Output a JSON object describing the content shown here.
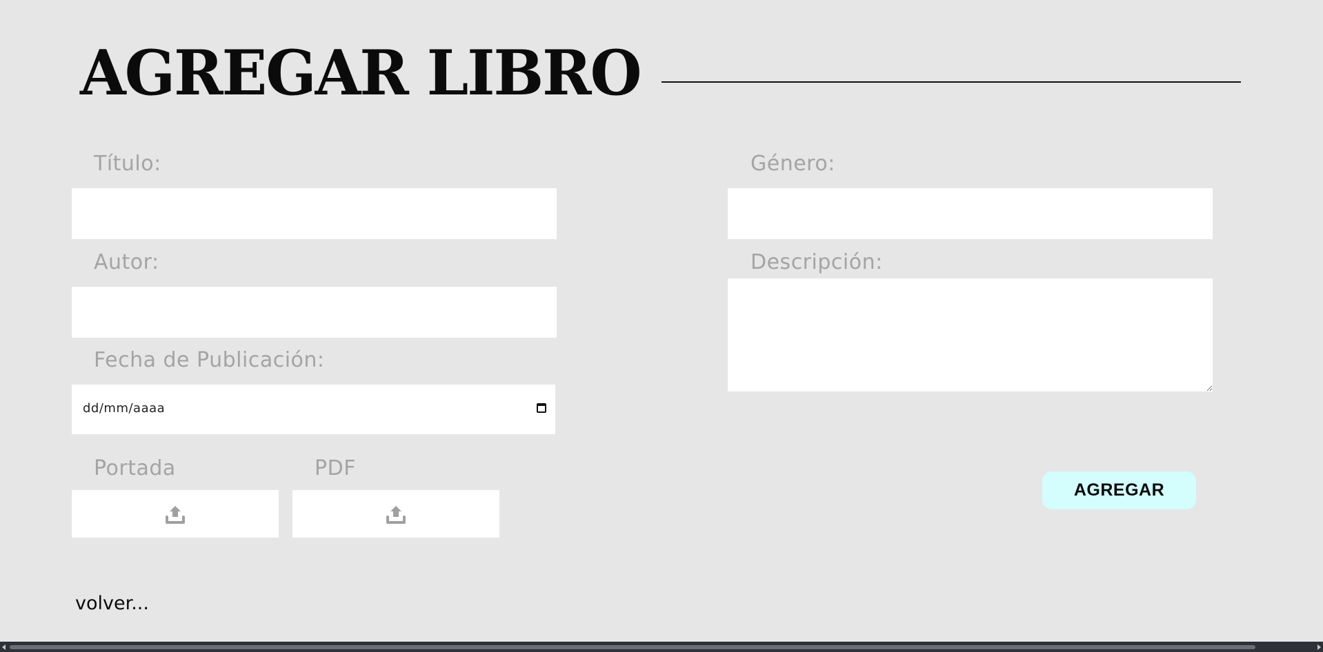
{
  "header": {
    "title": "AGREGAR LIBRO"
  },
  "form": {
    "titulo": {
      "label": "Título:",
      "value": ""
    },
    "autor": {
      "label": "Autor:",
      "value": ""
    },
    "fecha": {
      "label": "Fecha de Publicación:",
      "placeholder": "dd/mm/aaaa"
    },
    "genero": {
      "label": "Género:",
      "value": ""
    },
    "descripcion": {
      "label": "Descripción:",
      "value": ""
    },
    "portada": {
      "label": "Portada",
      "icon": "upload-icon"
    },
    "pdf": {
      "label": "PDF",
      "icon": "upload-icon"
    },
    "submit_label": "AGREGAR"
  },
  "footer": {
    "back_label": "volver..."
  },
  "colors": {
    "background": "#e6e6e6",
    "input_background": "#ffffff",
    "label": "#a4a4a4",
    "button": "#d4fdfd",
    "text": "#0a0a0a"
  }
}
